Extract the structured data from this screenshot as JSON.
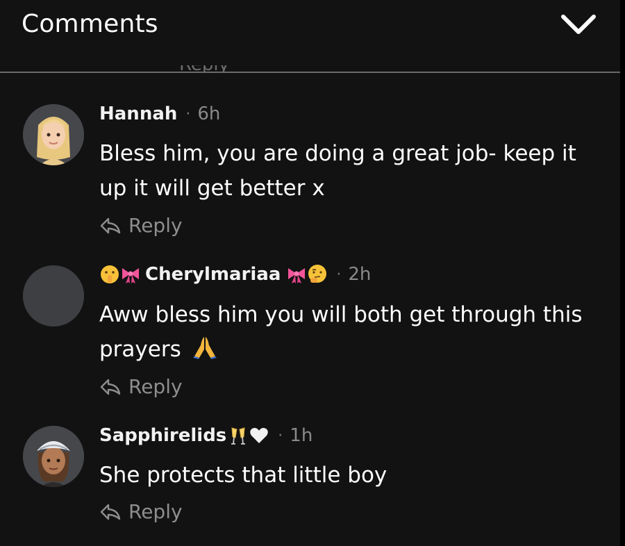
{
  "header": {
    "title": "Comments",
    "collapse_icon": "chevron-down-icon"
  },
  "peek": {
    "reply_label": "Reply"
  },
  "comments": [
    {
      "author": "Hannah",
      "separator": "·",
      "time": "6h",
      "text": "Bless him, you are doing a great job- keep it up it will get better x",
      "reply_label": "Reply",
      "avatar": "blonde-avatar"
    },
    {
      "author": "Cherylmariaa",
      "author_prefix_emoji": [
        "shushing-face-emoji",
        "pink-ribbon-emoji"
      ],
      "author_suffix_emoji": [
        "pink-ribbon-emoji",
        "thinking-face-emoji"
      ],
      "separator": "·",
      "time": "2h",
      "text": "Aww bless him you will both get through this prayers",
      "text_emoji": "folded-hands-emoji",
      "reply_label": "Reply",
      "avatar": "empty-avatar"
    },
    {
      "author": "Sapphirelids",
      "author_suffix_emoji": [
        "clinking-glasses-emoji",
        "white-heart-emoji"
      ],
      "separator": "·",
      "time": "1h",
      "text": "She protects that little boy",
      "reply_label": "Reply",
      "avatar": "bandana-avatar"
    }
  ],
  "colors": {
    "background": "#121212",
    "text": "#ffffff",
    "muted": "#8e8e8e",
    "divider": "#6a6a6a"
  }
}
